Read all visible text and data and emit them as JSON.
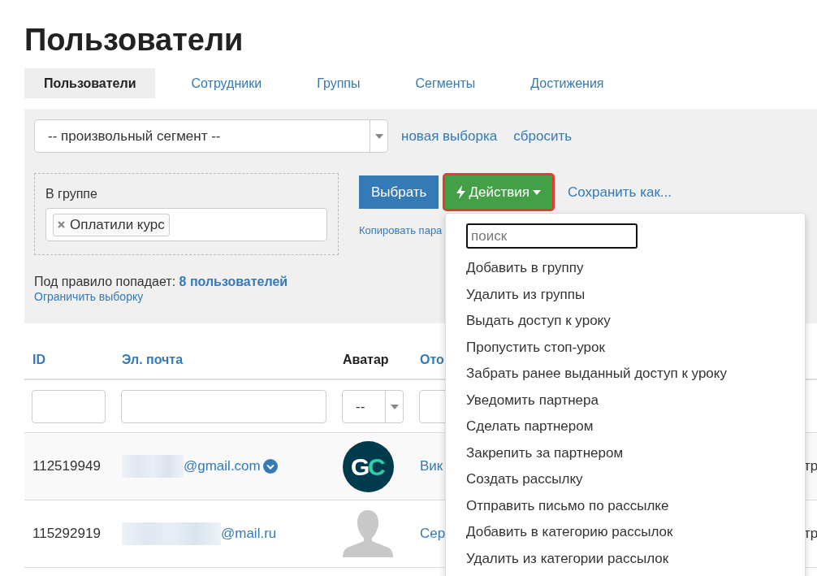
{
  "title": "Пользователи",
  "tabs": [
    {
      "label": "Пользователи",
      "selected": true
    },
    {
      "label": "Сотрудники",
      "selected": false
    },
    {
      "label": "Группы",
      "selected": false
    },
    {
      "label": "Сегменты",
      "selected": false
    },
    {
      "label": "Достижения",
      "selected": false
    }
  ],
  "filter": {
    "segment_select": "-- произвольный сегмент --",
    "links": [
      "новая выборка",
      "сбросить"
    ],
    "rule": {
      "label": "В группе",
      "tags": [
        "Оплатили курс"
      ]
    },
    "select_button": "Выбрать",
    "copy_link": "Копировать пара",
    "actions_button": "Действия",
    "save_link": "Сохранить как...",
    "summary": "Под правило попадает: **8 пользователей**",
    "limit_link": "Ограничить выборку"
  },
  "actions_menu": {
    "search": {
      "placeholder": "поиск"
    },
    "items": [
      "Добавить в группу",
      "Удалить из группы",
      "Выдать доступ к уроку",
      "Пропустить стоп-урок",
      "Забрать ранее выданный доступ к уроку",
      "Уведомить партнера",
      "Сделать партнером",
      "Закрепить за партнером",
      "Создать рассылку",
      "Отправить письмо по рассылке",
      "Добавить в категорию рассылок",
      "Удалить из категории рассылок"
    ]
  },
  "table": {
    "columns": [
      {
        "label": "ID",
        "link": true,
        "filter": {
          "kind": "input"
        }
      },
      {
        "label": "Эл. почта",
        "link": true,
        "filter": {
          "kind": "input"
        }
      },
      {
        "label": "Аватар",
        "link": false,
        "filter": {
          "kind": "select",
          "value": "--"
        }
      },
      {
        "label": "Ото",
        "link": true,
        "filter": {
          "kind": "input"
        }
      }
    ],
    "rows": [
      {
        "id": "112519949",
        "email": "@gmail.com",
        "verified": true,
        "avatar": {
          "kind": "logo",
          "letters": [
            "G",
            "C"
          ]
        },
        "column_4": "Вик",
        "column_5": "тр"
      },
      {
        "id": "115292919",
        "email": "@mail.ru",
        "verified": false,
        "avatar": {
          "kind": "silhouette"
        },
        "column_4": "Сер",
        "column_5": "тр"
      }
    ]
  }
}
